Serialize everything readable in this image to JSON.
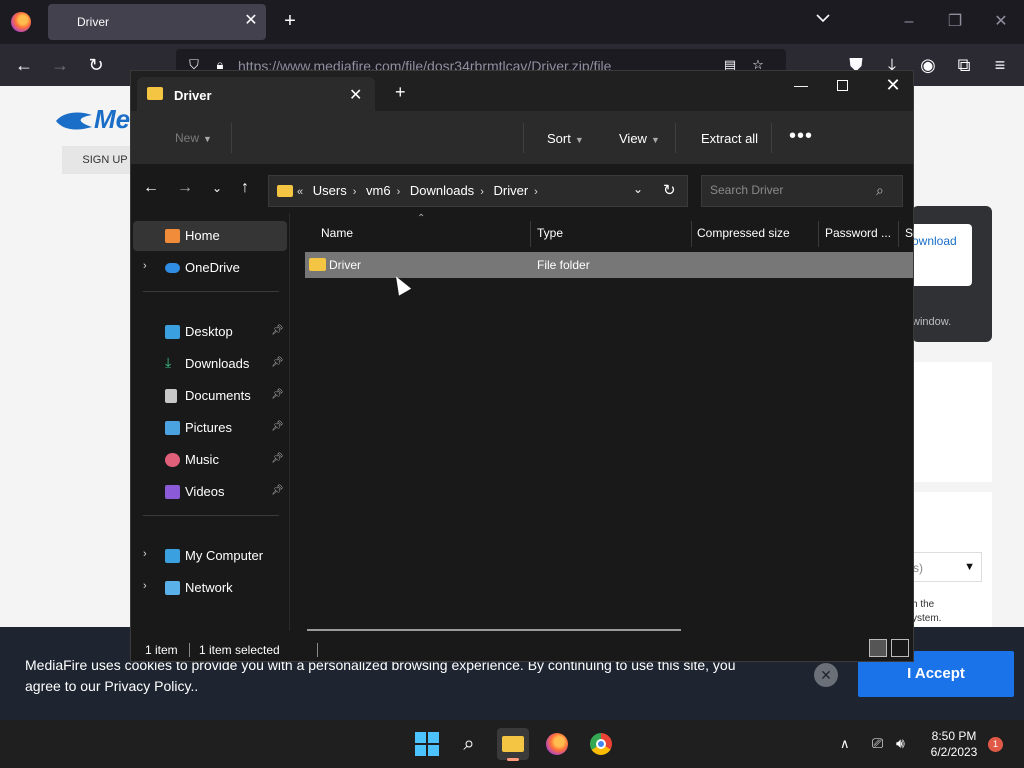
{
  "browser": {
    "tab_title": "Driver",
    "url": "https://www.mediafire.com/file/dosr34rbrmtlcav/Driver.zip/file"
  },
  "page": {
    "logo_text": "Me",
    "signup_label": "SIGN UP",
    "download_label": "ownload",
    "download_sub": "l",
    "window_text": "window.",
    "select_partial": "s)",
    "small_text_1": "h the",
    "small_text_2": "ystem."
  },
  "cookie": {
    "text": "MediaFire uses cookies to provide you with a personalized browsing experience. By continuing to use this site, you agree to our Privacy Policy..",
    "accept_label": "I Accept"
  },
  "explorer": {
    "tab_title": "Driver",
    "commands": {
      "new": "New",
      "sort": "Sort",
      "view": "View",
      "extract_all": "Extract all",
      "more": "•••"
    },
    "breadcrumbs": [
      "Users",
      "vm6",
      "Downloads",
      "Driver"
    ],
    "search_placeholder": "Search Driver",
    "sidebar": {
      "home": "Home",
      "onedrive": "OneDrive",
      "desktop": "Desktop",
      "downloads": "Downloads",
      "documents": "Documents",
      "pictures": "Pictures",
      "music": "Music",
      "videos": "Videos",
      "my_computer": "My Computer",
      "network": "Network"
    },
    "columns": {
      "name": "Name",
      "type": "Type",
      "compressed_size": "Compressed size",
      "password": "Password ...",
      "size": "Si"
    },
    "files": [
      {
        "name": "Driver",
        "type": "File folder"
      }
    ],
    "status": {
      "count": "1 item",
      "selected": "1 item selected"
    }
  },
  "taskbar": {
    "time": "8:50 PM",
    "date": "6/2/2023",
    "notification_count": "1"
  },
  "colors": {
    "accent_blue": "#1a73e8",
    "folder_yellow": "#f4c542",
    "explorer_bg": "#191919"
  }
}
